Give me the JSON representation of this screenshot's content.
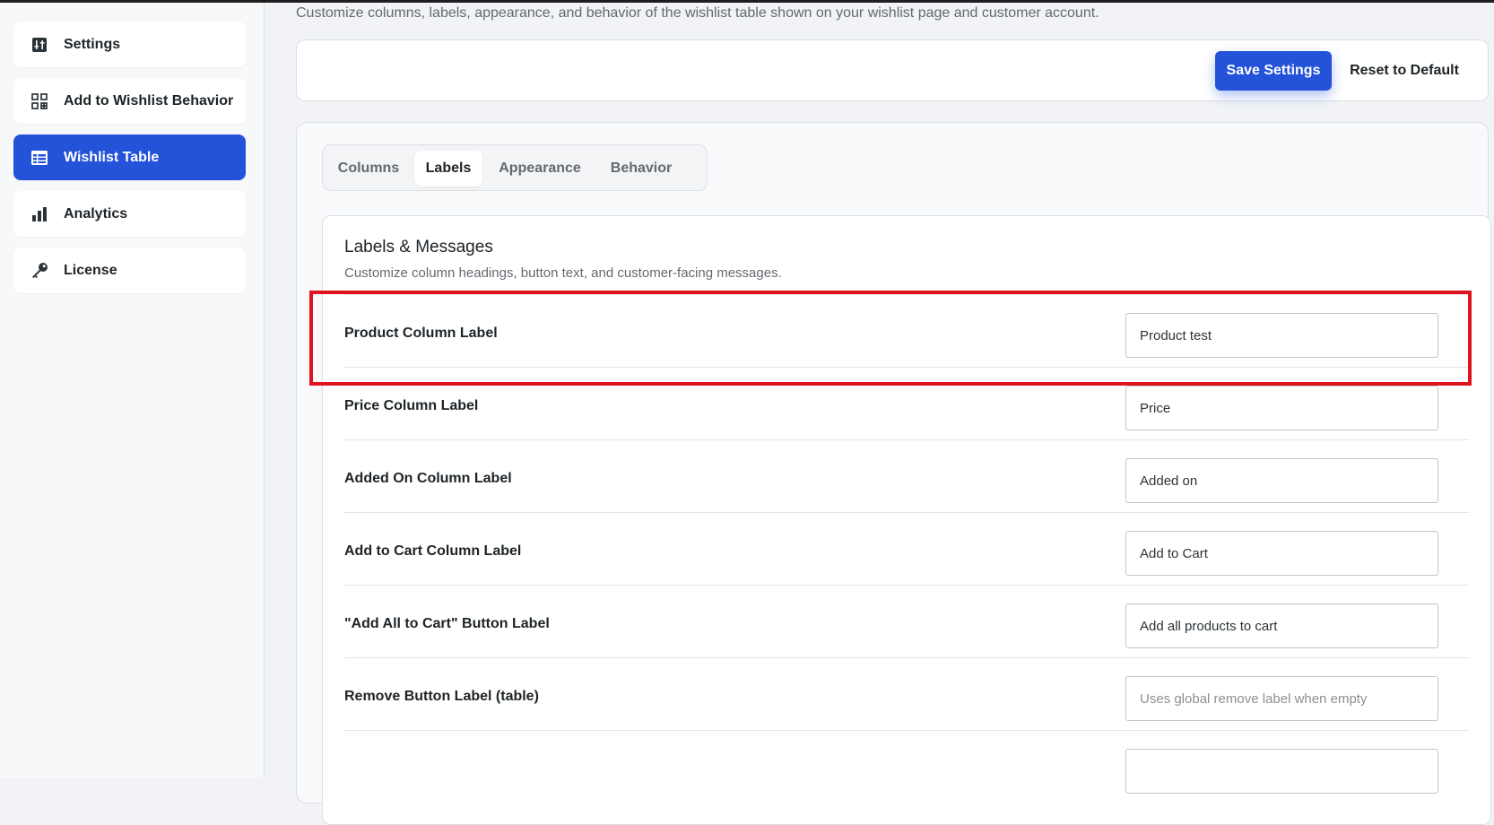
{
  "sidebar": {
    "items": [
      {
        "label": "Settings",
        "icon": "sliders-icon"
      },
      {
        "label": "Add to Wishlist Behavior",
        "icon": "grid-icon"
      },
      {
        "label": "Wishlist Table",
        "icon": "table-icon",
        "active": true
      },
      {
        "label": "Analytics",
        "icon": "bar-chart-icon"
      },
      {
        "label": "License",
        "icon": "key-icon"
      }
    ]
  },
  "header": {
    "subtitle": "Customize columns, labels, appearance, and behavior of the wishlist table shown on your wishlist page and customer account."
  },
  "actions": {
    "save_label": "Save Settings",
    "reset_label": "Reset to Default"
  },
  "tabs": [
    {
      "label": "Columns"
    },
    {
      "label": "Labels",
      "active": true
    },
    {
      "label": "Appearance"
    },
    {
      "label": "Behavior"
    }
  ],
  "card": {
    "title": "Labels & Messages",
    "description": "Customize column headings, button text, and customer-facing messages."
  },
  "fields": [
    {
      "label": "Product Column Label",
      "value": "Product test",
      "placeholder": ""
    },
    {
      "label": "Price Column Label",
      "value": "Price",
      "placeholder": ""
    },
    {
      "label": "Added On Column Label",
      "value": "Added on",
      "placeholder": ""
    },
    {
      "label": "Add to Cart Column Label",
      "value": "Add to Cart",
      "placeholder": ""
    },
    {
      "label": "\"Add All to Cart\" Button Label",
      "value": "Add all products to cart",
      "placeholder": ""
    },
    {
      "label": "Remove Button Label (table)",
      "value": "",
      "placeholder": "Uses global remove label when empty"
    }
  ],
  "colors": {
    "accent": "#2452d9",
    "highlight": "#e0121e"
  }
}
